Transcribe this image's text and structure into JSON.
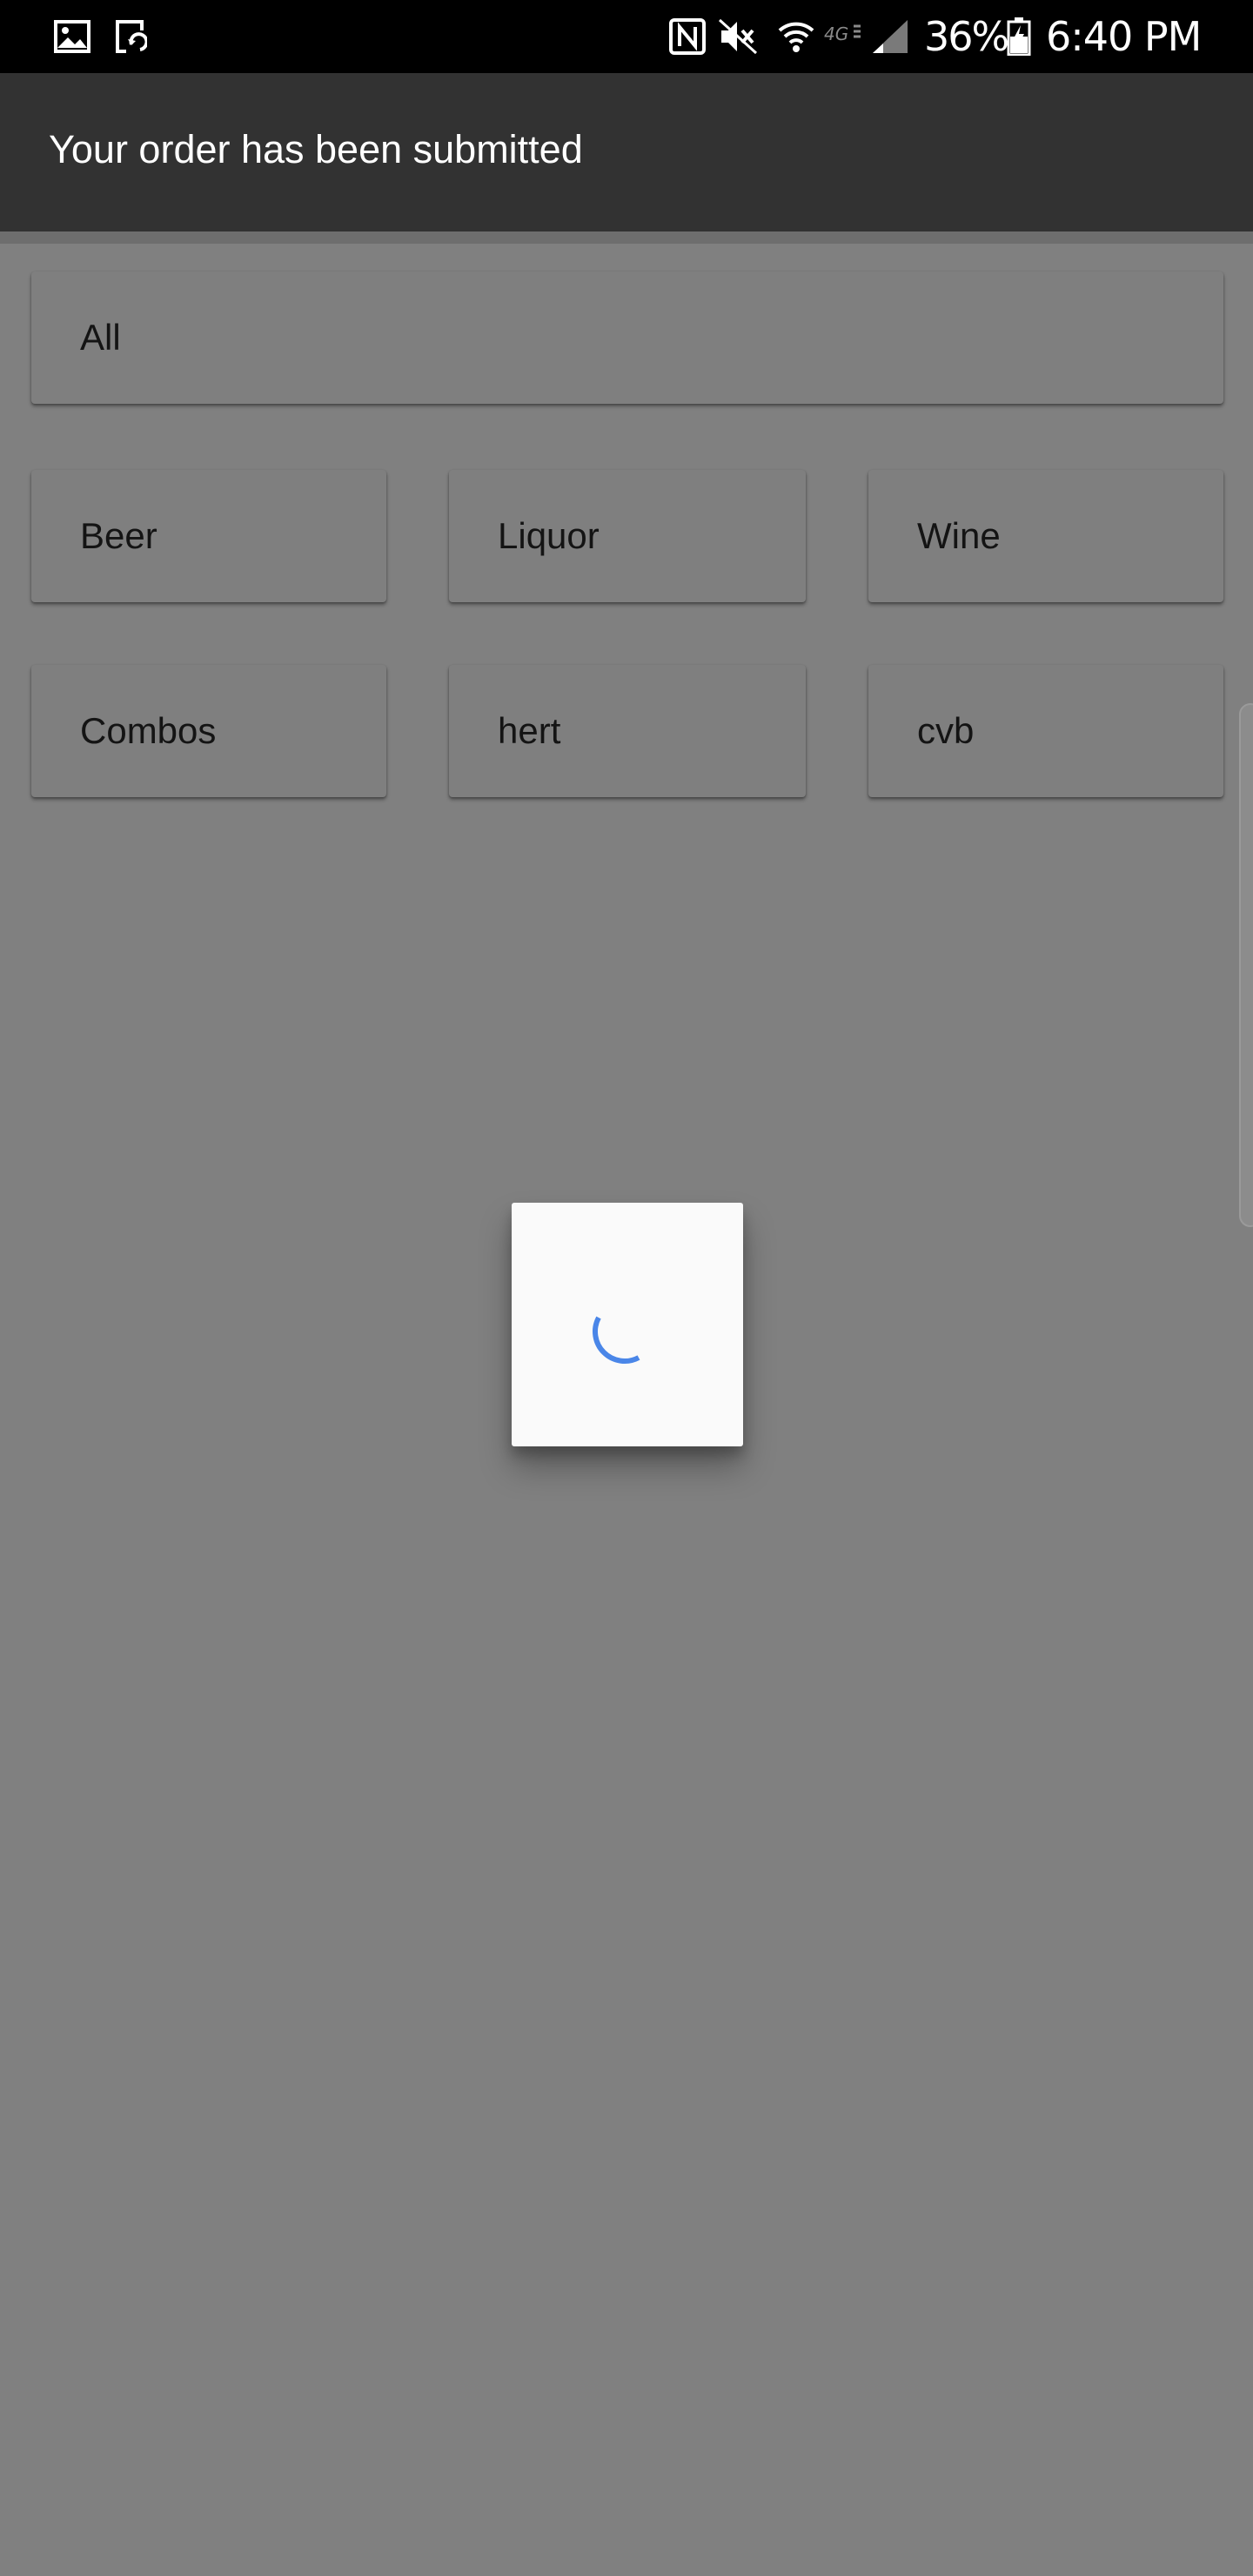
{
  "status_bar": {
    "battery_percent": "36%",
    "time": "6:40 PM",
    "icons": [
      "image-icon",
      "screen-rotation-icon",
      "nfc-icon",
      "mute-icon",
      "wifi-icon",
      "4g-icon",
      "signal-icon",
      "battery-charging-icon"
    ]
  },
  "app_bar": {
    "title": "Your order has been submitted"
  },
  "categories": {
    "all": "All",
    "beer": "Beer",
    "liquor": "Liquor",
    "wine": "Wine",
    "combos": "Combos",
    "hert": "hert",
    "cvb": "cvb"
  },
  "loading_dialog": {
    "icon": "progress-spinner-icon",
    "accent_color": "#4a86e8"
  },
  "colors": {
    "scrim": "#808080",
    "app_bar": "#323232",
    "status_bar": "#000000"
  }
}
